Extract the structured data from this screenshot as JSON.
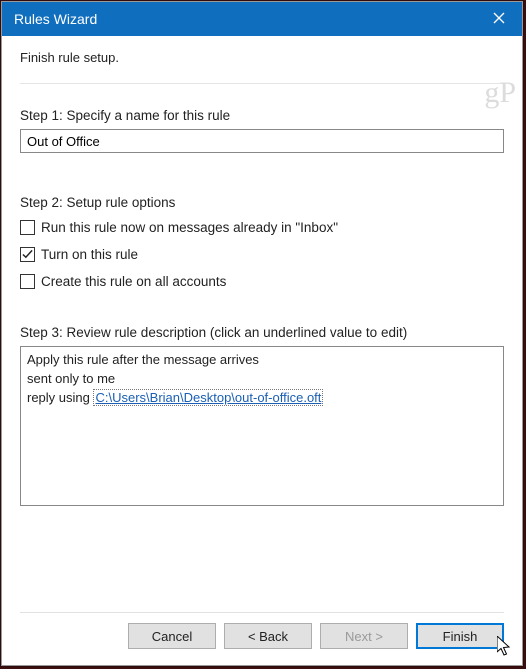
{
  "titlebar": {
    "title": "Rules Wizard"
  },
  "instruction": "Finish rule setup.",
  "step1": {
    "label": "Step 1: Specify a name for this rule",
    "value": "Out of Office"
  },
  "step2": {
    "label": "Step 2: Setup rule options",
    "options": [
      {
        "label": "Run this rule now on messages already in \"Inbox\"",
        "checked": false
      },
      {
        "label": "Turn on this rule",
        "checked": true
      },
      {
        "label": "Create this rule on all accounts",
        "checked": false
      }
    ]
  },
  "step3": {
    "label": "Step 3: Review rule description (click an underlined value to edit)",
    "line1": "Apply this rule after the message arrives",
    "line2": "sent only to me",
    "line3_prefix": "reply using ",
    "line3_link": "C:\\Users\\Brian\\Desktop\\out-of-office.oft"
  },
  "buttons": {
    "cancel": "Cancel",
    "back": "< Back",
    "next": "Next >",
    "finish": "Finish"
  },
  "watermark": "gP"
}
